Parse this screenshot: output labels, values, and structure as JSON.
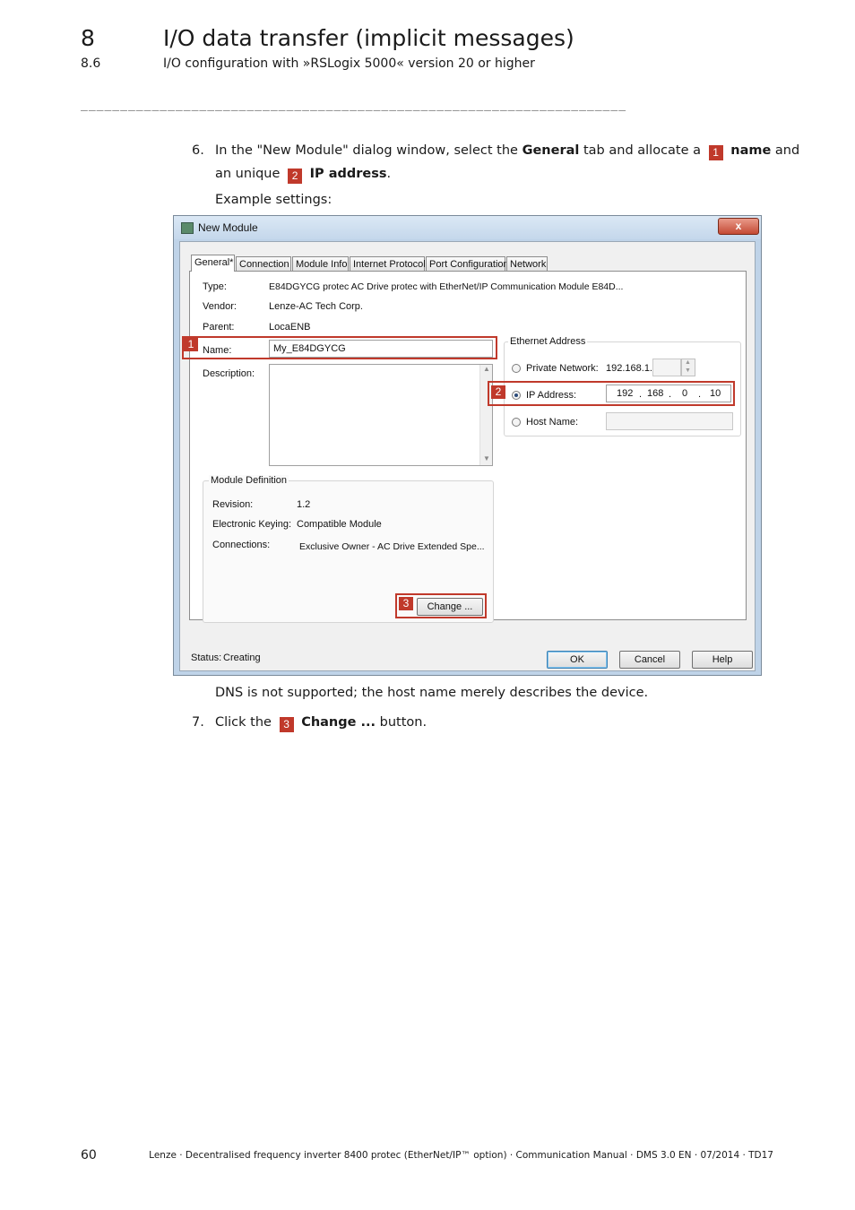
{
  "header": {
    "chapter_number": "8",
    "chapter_title": "I/O data transfer (implicit messages)",
    "section_number": "8.6",
    "section_title": "I/O configuration with »RSLogix 5000« version 20 or higher",
    "rule": "_____________________________________________________________________"
  },
  "steps": {
    "step6": {
      "number": "6.",
      "text_a": "In the \"New Module\" dialog window, select the ",
      "bold_general": "General",
      "text_b": " tab and allocate a ",
      "marker1": "1",
      "bold_name": "name",
      "text_c": " and",
      "text_d": "an unique ",
      "marker2": "2",
      "bold_ip": "IP address",
      "text_e": ".",
      "example": "Example settings:"
    },
    "dns_note": "DNS is not supported; the host name merely describes the device.",
    "step7": {
      "number": "7.",
      "text_a": "Click the ",
      "marker3": "3",
      "bold_change": "Change ...",
      "text_b": " button."
    }
  },
  "dialog": {
    "title": "New Module",
    "close_glyph": "x",
    "tabs": [
      "General*",
      "Connection",
      "Module Info",
      "Internet Protocol",
      "Port Configuration",
      "Network"
    ],
    "fields": {
      "type_label": "Type:",
      "type_value": "E84DGYCG protec AC Drive protec with EtherNet/IP Communication Module E84D...",
      "vendor_label": "Vendor:",
      "vendor_value": "Lenze-AC Tech Corp.",
      "parent_label": "Parent:",
      "parent_value": "LocaENB",
      "name_label": "Name:",
      "name_value": "My_E84DGYCG",
      "description_label": "Description:"
    },
    "ethernet": {
      "legend": "Ethernet Address",
      "private_label": "Private Network:",
      "private_prefix": "192.168.1.",
      "ip_label": "IP Address:",
      "ip_octets": [
        "192",
        "168",
        "0",
        "10"
      ],
      "ip_dot": ".",
      "host_label": "Host Name:"
    },
    "module_definition": {
      "legend": "Module Definition",
      "revision_label": "Revision:",
      "revision_value": "1.2",
      "keying_label": "Electronic Keying:",
      "keying_value": "Compatible Module",
      "connections_label": "Connections:",
      "connections_value": "Exclusive Owner - AC Drive Extended Spe...",
      "change_button": "Change ..."
    },
    "status_label": "Status:",
    "status_value": "Creating",
    "buttons": {
      "ok": "OK",
      "cancel": "Cancel",
      "help": "Help"
    },
    "markers": [
      "1",
      "2",
      "3"
    ],
    "highlight_color": "#c0392b"
  },
  "footer": {
    "page_number": "60",
    "doc_info": "Lenze · Decentralised frequency inverter 8400 protec (EtherNet/IP™ option) · Communication Manual · DMS 3.0 EN · 07/2014 · TD17"
  }
}
